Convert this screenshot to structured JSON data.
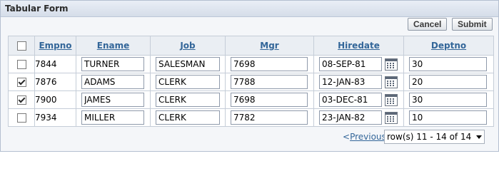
{
  "region": {
    "title": "Tabular Form"
  },
  "buttons": {
    "cancel": "Cancel",
    "submit": "Submit"
  },
  "columns": {
    "empno": "Empno",
    "ename": "Ename",
    "job": "Job",
    "mgr": "Mgr",
    "hiredate": "Hiredate",
    "deptno": "Deptno"
  },
  "rows": [
    {
      "checked": false,
      "empno": "7844",
      "ename": "TURNER",
      "job": "SALESMAN",
      "mgr": "7698",
      "hiredate": "08-SEP-81",
      "deptno": "30"
    },
    {
      "checked": true,
      "empno": "7876",
      "ename": "ADAMS",
      "job": "CLERK",
      "mgr": "7788",
      "hiredate": "12-JAN-83",
      "deptno": "20"
    },
    {
      "checked": true,
      "empno": "7900",
      "ename": "JAMES",
      "job": "CLERK",
      "mgr": "7698",
      "hiredate": "03-DEC-81",
      "deptno": "30"
    },
    {
      "checked": false,
      "empno": "7934",
      "ename": "MILLER",
      "job": "CLERK",
      "mgr": "7782",
      "hiredate": "23-JAN-82",
      "deptno": "10"
    }
  ],
  "pagination": {
    "prev_arrow": "<",
    "previous": "Previous",
    "selected": "row(s) 11 - 14 of 14"
  },
  "icons": {
    "calendar": "calendar-icon",
    "dropdown": "chevron-down-icon",
    "checkbox": "checkbox"
  }
}
